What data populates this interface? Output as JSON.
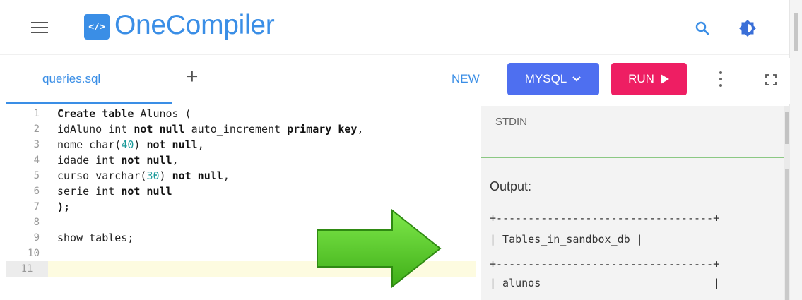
{
  "header": {
    "logo_glyph": "</>",
    "app_name": "OneCompiler",
    "brand_color": "#3a8ee6",
    "icons": [
      "hamburger-menu-icon",
      "search-icon",
      "theme-toggle-icon"
    ]
  },
  "toolbar": {
    "file_tab": "queries.sql",
    "add_tab": "+",
    "new_label": "NEW",
    "language_label": "MYSQL",
    "language_color": "#4e6ff0",
    "run_label": "RUN",
    "run_color": "#ee1e63"
  },
  "editor": {
    "lines": [
      {
        "n": "1",
        "segs": [
          [
            "Create table",
            "kw"
          ],
          [
            " Alunos (",
            ""
          ]
        ]
      },
      {
        "n": "2",
        "segs": [
          [
            "idAluno int ",
            ""
          ],
          [
            "not null",
            "kw"
          ],
          [
            " auto_increment ",
            ""
          ],
          [
            "primary key",
            "kw"
          ],
          [
            ",",
            ""
          ]
        ]
      },
      {
        "n": "3",
        "segs": [
          [
            "nome char(",
            ""
          ],
          [
            "40",
            "num"
          ],
          [
            ") ",
            ""
          ],
          [
            "not null",
            "kw"
          ],
          [
            ",",
            ""
          ]
        ]
      },
      {
        "n": "4",
        "segs": [
          [
            "idade int ",
            ""
          ],
          [
            "not null",
            "kw"
          ],
          [
            ",",
            ""
          ]
        ]
      },
      {
        "n": "5",
        "segs": [
          [
            "curso varchar(",
            ""
          ],
          [
            "30",
            "num"
          ],
          [
            ") ",
            ""
          ],
          [
            "not null",
            "kw"
          ],
          [
            ",",
            ""
          ]
        ]
      },
      {
        "n": "6",
        "segs": [
          [
            "serie int ",
            ""
          ],
          [
            "not null",
            "kw"
          ]
        ]
      },
      {
        "n": "7",
        "segs": [
          [
            ");",
            "kw"
          ]
        ]
      },
      {
        "n": "8",
        "segs": []
      },
      {
        "n": "9",
        "segs": [
          [
            "show tables;",
            ""
          ]
        ]
      },
      {
        "n": "10",
        "segs": []
      },
      {
        "n": "11",
        "segs": []
      }
    ],
    "active_line": "11"
  },
  "stdin": {
    "label": "STDIN"
  },
  "output": {
    "label": "Output:",
    "lines": [
      "+----------------------------------+",
      "| Tables_in_sandbox_db |",
      "+----------------------------------+",
      "| alunos                           |"
    ]
  }
}
